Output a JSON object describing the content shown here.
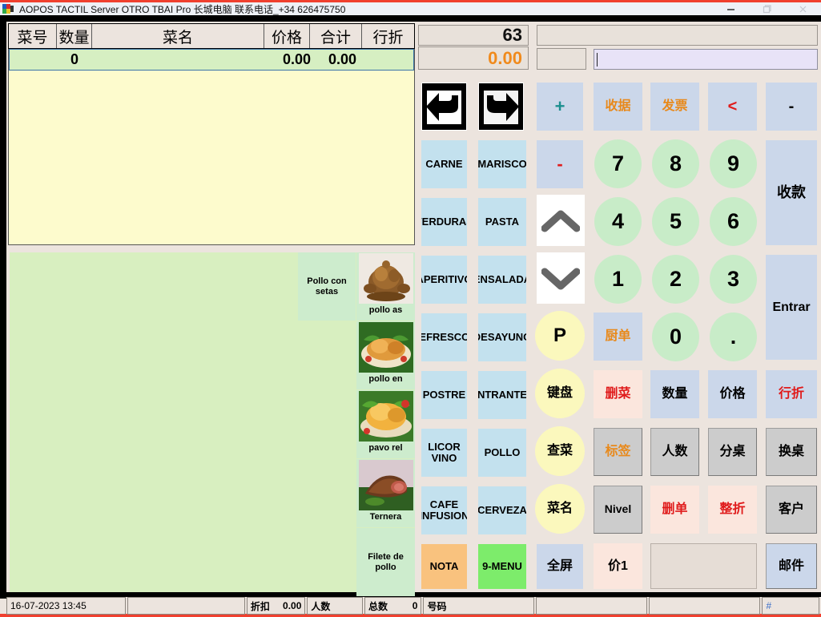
{
  "window": {
    "title": "AOPOS TACTIL Server OTRO TBAI Pro 长城电脑 联系电话_+34 626475750",
    "minimize_label": "—",
    "maximize_label": "❐",
    "close_label": "✕"
  },
  "order_table": {
    "headers": [
      "菜号",
      "数量",
      "菜名",
      "价格",
      "合计",
      "行折"
    ],
    "rows": [
      {
        "code": "",
        "qty": "0",
        "name": "",
        "price": "0.00",
        "total": "0.00",
        "discount": ""
      }
    ]
  },
  "readouts": {
    "count": "63",
    "amount": "0.00",
    "wide_value": "",
    "small_value": "",
    "input_value": "",
    "input_placeholder": ""
  },
  "products": {
    "column_a": [
      {
        "label": "Pollo con setas",
        "image": "roast-chicken-photo",
        "has_image": false
      }
    ],
    "column_b": [
      {
        "label": "pollo as",
        "image": "roast-chicken-photo",
        "has_image": true
      },
      {
        "label": "pollo en",
        "image": "roast-chicken-platter-photo",
        "has_image": true
      },
      {
        "label": "pavo rel",
        "image": "roast-turkey-photo",
        "has_image": true
      },
      {
        "label": "Ternera",
        "image": "roast-beef-photo",
        "has_image": true
      },
      {
        "label": "Filete de pollo",
        "image": "",
        "has_image": false
      }
    ]
  },
  "nav": {
    "prev_icon": "arrow-left-icon",
    "next_icon": "arrow-right-icon"
  },
  "categories": [
    {
      "label": "CARNE",
      "color": "lblue"
    },
    {
      "label": "MARISCO",
      "color": "lblue"
    },
    {
      "label": "VERDURAS",
      "color": "lblue"
    },
    {
      "label": "PASTA",
      "color": "lblue"
    },
    {
      "label": "APERITIVO",
      "color": "lblue"
    },
    {
      "label": "ENSALADA",
      "color": "lblue"
    },
    {
      "label": "REFRESCOS",
      "color": "lblue"
    },
    {
      "label": "DESAYUNO",
      "color": "lblue"
    },
    {
      "label": "POSTRE",
      "color": "lblue"
    },
    {
      "label": "ENTRANTES",
      "color": "lblue"
    },
    {
      "label": "LICOR VINO",
      "color": "lblue"
    },
    {
      "label": "POLLO",
      "color": "lblue"
    },
    {
      "label": "CAFE INFUSION",
      "color": "lblue"
    },
    {
      "label": "CERVEZA",
      "color": "lblue"
    },
    {
      "label": "NOTA",
      "color": "orange"
    },
    {
      "label": "9-MENU",
      "color": "green"
    }
  ],
  "tools": {
    "plus": "+",
    "minus": "-",
    "up_icon": "chevron-up-icon",
    "down_icon": "chevron-down-icon",
    "parking": "P",
    "keyboard": "键盘",
    "find_dish": "查菜",
    "dish_name": "菜名",
    "fullscreen": "全屏"
  },
  "actions": {
    "receipt": "收据",
    "invoice": "发票",
    "backspace": "<",
    "dash": "-",
    "kitchen_ticket": "厨单",
    "delete_item": "删菜",
    "quantity": "数量",
    "price": "价格",
    "line_discount": "行折",
    "label": "标签",
    "people": "人数",
    "split_table": "分桌",
    "change_table": "换桌",
    "nivel": "Nivel",
    "delete_order": "删单",
    "whole_discount": "整折",
    "customer": "客户",
    "price1": "价1",
    "blank": "",
    "mail": "邮件",
    "charge": "收款",
    "enter": "Entrar"
  },
  "keypad": [
    "7",
    "8",
    "9",
    "4",
    "5",
    "6",
    "1",
    "2",
    "3",
    "0",
    "."
  ],
  "statusbar": {
    "datetime": "16-07-2023 13:45",
    "spacer": "",
    "discount_label": "折扣",
    "discount_value": "0.00",
    "people_label": "人数",
    "people_value": "",
    "total_label": "总数",
    "total_value": "0",
    "number_label": "号码",
    "number_value": "",
    "field_a": "",
    "field_b": "",
    "hash": "#"
  },
  "colors": {
    "accent_red": "#f0402f",
    "amount_orange": "#f08a1c",
    "button_blue": "#cbd7ea",
    "category_blue": "#c3e1ee",
    "keypad_green": "#c8ecc8",
    "oval_yellow": "#fbf8bd",
    "panel_green": "#d8efc0",
    "list_yellow": "#fdfbcd"
  }
}
